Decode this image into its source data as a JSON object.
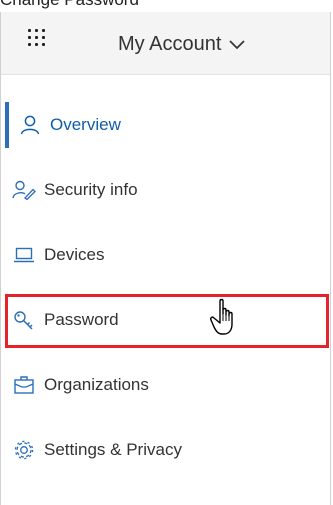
{
  "top_text": "Change Password",
  "header": {
    "title": "My Account",
    "app_launcher_icon": "waffle-icon",
    "chevron_icon": "chevron-down-icon"
  },
  "nav": {
    "items": [
      {
        "label": "Overview",
        "icon": "person-icon",
        "active": true
      },
      {
        "label": "Security info",
        "icon": "security-info-icon",
        "active": false
      },
      {
        "label": "Devices",
        "icon": "laptop-icon",
        "active": false
      },
      {
        "label": "Password",
        "icon": "key-icon",
        "active": false,
        "highlighted": true
      },
      {
        "label": "Organizations",
        "icon": "briefcase-icon",
        "active": false
      },
      {
        "label": "Settings & Privacy",
        "icon": "gear-icon",
        "active": false
      }
    ]
  },
  "colors": {
    "accent": "#0f5fa8",
    "highlight": "#e5232b",
    "header_bg": "#f4f4f4"
  }
}
